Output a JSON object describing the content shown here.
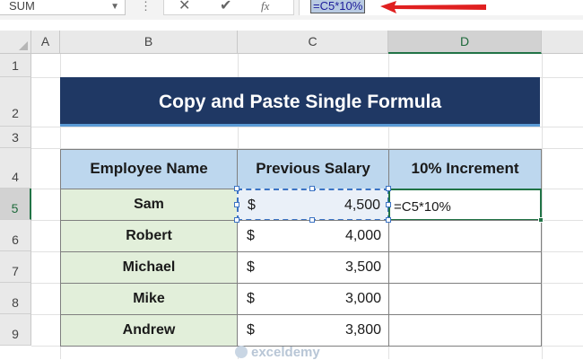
{
  "formula_bar": {
    "name_box": "SUM",
    "name_box_icon": "chevron-down-icon",
    "formula": "=C5*10%",
    "tools": [
      "cancel-icon",
      "enter-check-icon",
      "insert-function-icon"
    ],
    "fx_label": "fx"
  },
  "columns": [
    "A",
    "B",
    "C",
    "D"
  ],
  "rows": [
    "1",
    "2",
    "3",
    "4",
    "5",
    "6",
    "7",
    "8",
    "9"
  ],
  "title": "Copy and Paste Single Formula",
  "table": {
    "headers": [
      "Employee Name",
      "Previous Salary",
      "10% Increment"
    ],
    "currency": "$",
    "rows": [
      {
        "name": "Sam",
        "salary": "4,500",
        "increment": "=C5*10%"
      },
      {
        "name": "Robert",
        "salary": "4,000",
        "increment": ""
      },
      {
        "name": "Michael",
        "salary": "3,500",
        "increment": ""
      },
      {
        "name": "Mike",
        "salary": "3,000",
        "increment": ""
      },
      {
        "name": "Andrew",
        "salary": "3,800",
        "increment": ""
      }
    ]
  },
  "watermark": "exceldemy",
  "colors": {
    "title_bg": "#1f3864",
    "header_bg": "#bdd7ee",
    "name_bg": "#e2efda",
    "accent_green": "#217346",
    "arrow_red": "#e02020"
  }
}
